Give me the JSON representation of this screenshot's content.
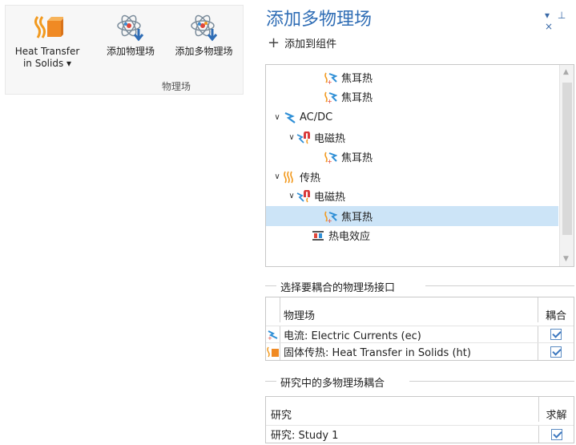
{
  "ribbon": {
    "buttons": [
      {
        "label": "Heat Transfer in Solids ▾",
        "line1": "Heat Transfer",
        "line2": "in Solids ▾",
        "icon": "heat-transfer-solids-icon"
      },
      {
        "label": "添加物理场",
        "icon": "add-physics-icon"
      },
      {
        "label": "添加多物理场",
        "icon": "add-multiphysics-icon"
      }
    ],
    "group_label": "物理场"
  },
  "panel": {
    "title": "添加多物理场",
    "controls": "▾ ⊥ ×",
    "add_to_component": "添加到组件",
    "tree": [
      {
        "label": "焦耳热",
        "indent": 3,
        "icon": "joule-heating-icon",
        "expand": ""
      },
      {
        "label": "焦耳热",
        "indent": 3,
        "icon": "joule-heating-icon",
        "expand": ""
      },
      {
        "label": "AC/DC",
        "indent": 0,
        "icon": "acdc-icon",
        "expand": "∨"
      },
      {
        "label": "电磁热",
        "indent": 1,
        "icon": "electromagnetic-heating-icon",
        "expand": "∨"
      },
      {
        "label": "焦耳热",
        "indent": 3,
        "icon": "joule-heating-icon",
        "expand": ""
      },
      {
        "label": "传热",
        "indent": 0,
        "icon": "heat-transfer-icon",
        "expand": "∨"
      },
      {
        "label": "电磁热",
        "indent": 1,
        "icon": "electromagnetic-heating-icon",
        "expand": "∨"
      },
      {
        "label": "焦耳热",
        "indent": 3,
        "icon": "joule-heating-icon",
        "expand": "",
        "selected": true
      },
      {
        "label": "热电效应",
        "indent": 2,
        "icon": "thermoelectric-icon",
        "expand": ""
      }
    ],
    "coupling_section": {
      "title": "选择要耦合的物理场接口",
      "header": {
        "physics": "物理场",
        "couple": "耦合"
      },
      "rows": [
        {
          "icon": "electric-currents-icon",
          "name": "电流: Electric Currents (ec)",
          "checked": true
        },
        {
          "icon": "heat-transfer-solids-icon",
          "name": "固体传热: Heat Transfer in Solids (ht)",
          "checked": true
        }
      ]
    },
    "study_section": {
      "title": "研究中的多物理场耦合",
      "header": {
        "study": "研究",
        "solve": "求解"
      },
      "rows": [
        {
          "name": "研究: Study 1",
          "checked": true
        }
      ]
    }
  },
  "colors": {
    "accent": "#2f6db5",
    "selection": "#cce4f7"
  }
}
